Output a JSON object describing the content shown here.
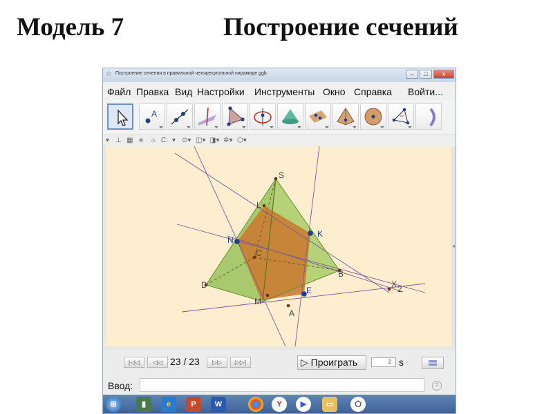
{
  "slide": {
    "title_left": "Модель 7",
    "title_right": "Построение сечений"
  },
  "window": {
    "title": "Построение сечения в правильной четырехугольной пирамиде.ggb",
    "controls": [
      "–",
      "□",
      "x"
    ]
  },
  "menu": [
    "Файл",
    "Правка",
    "Вид",
    "Настройки",
    "Инструменты",
    "Окно",
    "Справка",
    "Войти..."
  ],
  "toolbar": {
    "tools": [
      "move-tool-icon",
      "point-tool-icon",
      "line-tool-icon",
      "perpendicular-line-tool-icon",
      "polygon-tool-icon",
      "circle-tool-icon",
      "cone-tool-icon",
      "plane-tool-icon",
      "pyramid-tool-icon",
      "sphere-tool-icon",
      "angle-tool-icon",
      "rotate-view-tool-icon"
    ],
    "selected": "move-tool-icon"
  },
  "stylebar": {
    "label_style": "C:"
  },
  "geometry": {
    "points": {
      "S": "S",
      "L": "L",
      "K": "K",
      "N": "N",
      "C": "C",
      "B": "B",
      "D": "D",
      "X": "X",
      "X_sub": "2",
      "M": "M",
      "E": "E",
      "A": "A"
    },
    "colors": {
      "canvas_bg": "#fdeed0",
      "pyramid_fill": "#99c25a",
      "section_fill": "#c97a30",
      "lines": "#7a5a9a",
      "points": "#1f3f8a",
      "labels": "#444444"
    }
  },
  "playbar": {
    "step": "23 / 23",
    "play_label": "▷ Проиграть",
    "speed": "2",
    "speed_unit": "s"
  },
  "input": {
    "label": "Ввод:",
    "value": "",
    "help": "?"
  },
  "taskbar": {
    "apps": [
      "windows-start-icon",
      "network-app-icon",
      "ie-browser-icon",
      "powerpoint-icon",
      "word-icon",
      "chrome-icon",
      "yandex-browser-icon",
      "media-player-icon",
      "file-explorer-icon",
      "geogebra-icon"
    ]
  }
}
